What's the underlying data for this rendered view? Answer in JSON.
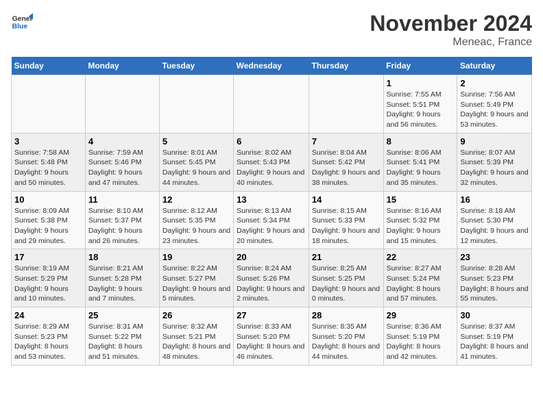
{
  "header": {
    "logo_line1": "General",
    "logo_line2": "Blue",
    "month_title": "November 2024",
    "location": "Meneac, France"
  },
  "weekdays": [
    "Sunday",
    "Monday",
    "Tuesday",
    "Wednesday",
    "Thursday",
    "Friday",
    "Saturday"
  ],
  "weeks": [
    [
      {
        "day": "",
        "info": ""
      },
      {
        "day": "",
        "info": ""
      },
      {
        "day": "",
        "info": ""
      },
      {
        "day": "",
        "info": ""
      },
      {
        "day": "",
        "info": ""
      },
      {
        "day": "1",
        "info": "Sunrise: 7:55 AM\nSunset: 5:51 PM\nDaylight: 9 hours and 56 minutes."
      },
      {
        "day": "2",
        "info": "Sunrise: 7:56 AM\nSunset: 5:49 PM\nDaylight: 9 hours and 53 minutes."
      }
    ],
    [
      {
        "day": "3",
        "info": "Sunrise: 7:58 AM\nSunset: 5:48 PM\nDaylight: 9 hours and 50 minutes."
      },
      {
        "day": "4",
        "info": "Sunrise: 7:59 AM\nSunset: 5:46 PM\nDaylight: 9 hours and 47 minutes."
      },
      {
        "day": "5",
        "info": "Sunrise: 8:01 AM\nSunset: 5:45 PM\nDaylight: 9 hours and 44 minutes."
      },
      {
        "day": "6",
        "info": "Sunrise: 8:02 AM\nSunset: 5:43 PM\nDaylight: 9 hours and 40 minutes."
      },
      {
        "day": "7",
        "info": "Sunrise: 8:04 AM\nSunset: 5:42 PM\nDaylight: 9 hours and 38 minutes."
      },
      {
        "day": "8",
        "info": "Sunrise: 8:06 AM\nSunset: 5:41 PM\nDaylight: 9 hours and 35 minutes."
      },
      {
        "day": "9",
        "info": "Sunrise: 8:07 AM\nSunset: 5:39 PM\nDaylight: 9 hours and 32 minutes."
      }
    ],
    [
      {
        "day": "10",
        "info": "Sunrise: 8:09 AM\nSunset: 5:38 PM\nDaylight: 9 hours and 29 minutes."
      },
      {
        "day": "11",
        "info": "Sunrise: 8:10 AM\nSunset: 5:37 PM\nDaylight: 9 hours and 26 minutes."
      },
      {
        "day": "12",
        "info": "Sunrise: 8:12 AM\nSunset: 5:35 PM\nDaylight: 9 hours and 23 minutes."
      },
      {
        "day": "13",
        "info": "Sunrise: 8:13 AM\nSunset: 5:34 PM\nDaylight: 9 hours and 20 minutes."
      },
      {
        "day": "14",
        "info": "Sunrise: 8:15 AM\nSunset: 5:33 PM\nDaylight: 9 hours and 18 minutes."
      },
      {
        "day": "15",
        "info": "Sunrise: 8:16 AM\nSunset: 5:32 PM\nDaylight: 9 hours and 15 minutes."
      },
      {
        "day": "16",
        "info": "Sunrise: 8:18 AM\nSunset: 5:30 PM\nDaylight: 9 hours and 12 minutes."
      }
    ],
    [
      {
        "day": "17",
        "info": "Sunrise: 8:19 AM\nSunset: 5:29 PM\nDaylight: 9 hours and 10 minutes."
      },
      {
        "day": "18",
        "info": "Sunrise: 8:21 AM\nSunset: 5:28 PM\nDaylight: 9 hours and 7 minutes."
      },
      {
        "day": "19",
        "info": "Sunrise: 8:22 AM\nSunset: 5:27 PM\nDaylight: 9 hours and 5 minutes."
      },
      {
        "day": "20",
        "info": "Sunrise: 8:24 AM\nSunset: 5:26 PM\nDaylight: 9 hours and 2 minutes."
      },
      {
        "day": "21",
        "info": "Sunrise: 8:25 AM\nSunset: 5:25 PM\nDaylight: 9 hours and 0 minutes."
      },
      {
        "day": "22",
        "info": "Sunrise: 8:27 AM\nSunset: 5:24 PM\nDaylight: 8 hours and 57 minutes."
      },
      {
        "day": "23",
        "info": "Sunrise: 8:28 AM\nSunset: 5:23 PM\nDaylight: 8 hours and 55 minutes."
      }
    ],
    [
      {
        "day": "24",
        "info": "Sunrise: 8:29 AM\nSunset: 5:23 PM\nDaylight: 8 hours and 53 minutes."
      },
      {
        "day": "25",
        "info": "Sunrise: 8:31 AM\nSunset: 5:22 PM\nDaylight: 8 hours and 51 minutes."
      },
      {
        "day": "26",
        "info": "Sunrise: 8:32 AM\nSunset: 5:21 PM\nDaylight: 8 hours and 48 minutes."
      },
      {
        "day": "27",
        "info": "Sunrise: 8:33 AM\nSunset: 5:20 PM\nDaylight: 8 hours and 46 minutes."
      },
      {
        "day": "28",
        "info": "Sunrise: 8:35 AM\nSunset: 5:20 PM\nDaylight: 8 hours and 44 minutes."
      },
      {
        "day": "29",
        "info": "Sunrise: 8:36 AM\nSunset: 5:19 PM\nDaylight: 8 hours and 42 minutes."
      },
      {
        "day": "30",
        "info": "Sunrise: 8:37 AM\nSunset: 5:19 PM\nDaylight: 8 hours and 41 minutes."
      }
    ]
  ]
}
